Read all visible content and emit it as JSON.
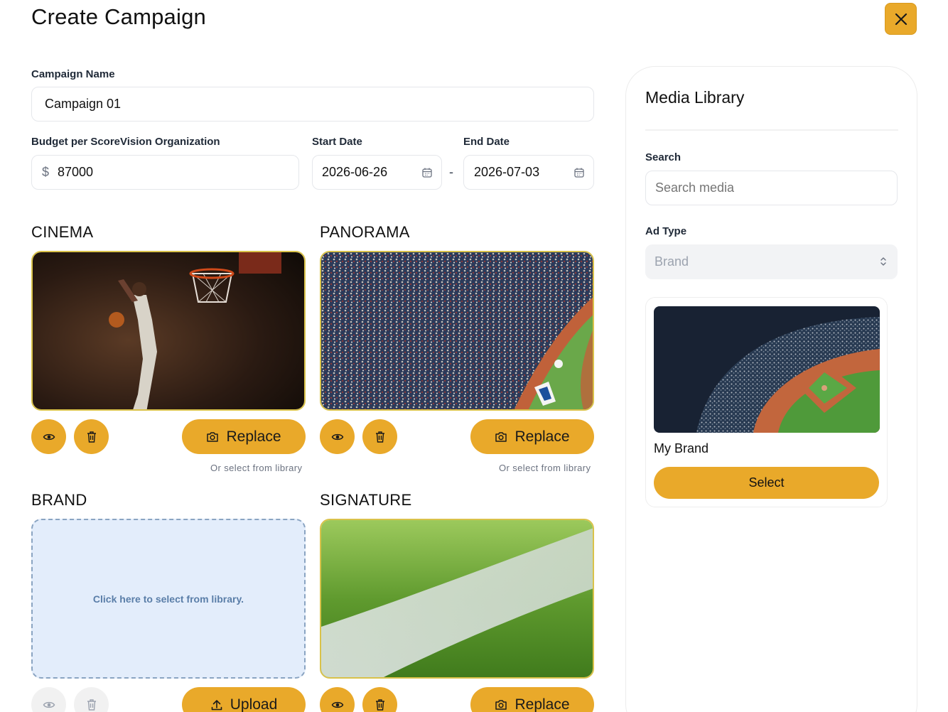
{
  "modal": {
    "title": "Create Campaign"
  },
  "form": {
    "campaign_name_label": "Campaign Name",
    "campaign_name_value": "Campaign 01",
    "budget_label": "Budget per ScoreVision Organization",
    "budget_currency": "$",
    "budget_value": "87000",
    "start_date_label": "Start Date",
    "start_date_value": "2026-06-26",
    "date_separator": "-",
    "end_date_label": "End Date",
    "end_date_value": "2026-07-03"
  },
  "slots": {
    "cinema": {
      "title": "CINEMA",
      "action": "Replace",
      "hint": "Or select from library"
    },
    "panorama": {
      "title": "PANORAMA",
      "action": "Replace",
      "hint": "Or select from library"
    },
    "brand": {
      "title": "BRAND",
      "empty_text": "Click here to select from library.",
      "action": "Upload"
    },
    "signature": {
      "title": "SIGNATURE",
      "action": "Replace"
    }
  },
  "library": {
    "title": "Media Library",
    "search_label": "Search",
    "search_placeholder": "Search media",
    "ad_type_label": "Ad Type",
    "ad_type_value": "Brand",
    "items": [
      {
        "name": "My Brand",
        "select_label": "Select"
      }
    ]
  },
  "icons": {
    "close": "close-icon",
    "calendar": "calendar-icon",
    "view": "eye-icon",
    "delete": "trash-icon",
    "replace": "camera-icon",
    "upload": "upload-icon",
    "select_chevron": "chevron-up-down-icon"
  },
  "colors": {
    "accent": "#e9a92a",
    "empty_slot_bg": "#e3edfb",
    "empty_slot_text": "#5a7ea8"
  }
}
